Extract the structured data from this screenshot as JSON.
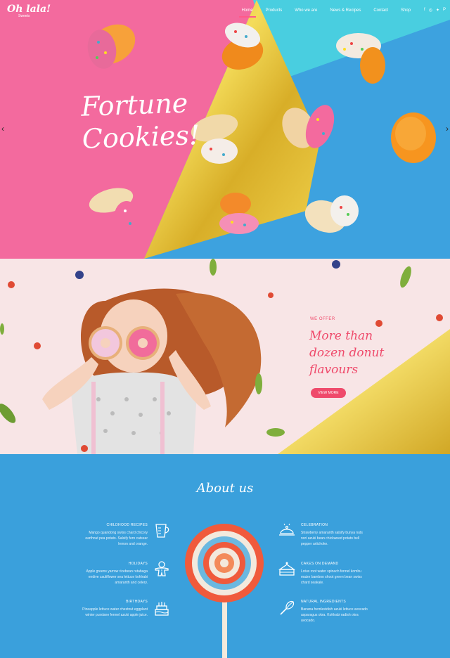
{
  "brand": {
    "logo": "Oh lala!",
    "tagline": "Sweets"
  },
  "nav": {
    "items": [
      {
        "label": "Home",
        "active": true
      },
      {
        "label": "Products"
      },
      {
        "label": "Who we are"
      },
      {
        "label": "News & Recipes"
      },
      {
        "label": "Contact"
      },
      {
        "label": "Shop"
      }
    ],
    "social": [
      "f",
      "◎",
      "✦",
      "P"
    ]
  },
  "hero": {
    "title_line1": "Fortune",
    "title_line2": "Cookies!",
    "prev": "‹",
    "next": "›"
  },
  "offer": {
    "label": "WE OFFER",
    "title_line1": "More than",
    "title_line2": "dozen donut",
    "title_line3": "flavours",
    "button": "VIEW MORE"
  },
  "about": {
    "title": "About us",
    "left": [
      {
        "title": "CHILDHOOD RECIPES",
        "text": "Mango quandong swiss chard chicory earthnut pea potato. Salsify fern catsear lemon and orange.",
        "icon": "measuring-cup-icon"
      },
      {
        "title": "HOLIDAYS",
        "text": "Apple greens yarrow ricebean rutabaga endive cauliflower sea lettuce kohlrabi amaranth and celery.",
        "icon": "gingerbread-man-icon"
      },
      {
        "title": "BIRTHDAYS",
        "text": "Pineapple lettuce water chestnut eggplant winter purslane fennel azuki apple juice.",
        "icon": "birthday-cake-icon"
      }
    ],
    "right": [
      {
        "title": "CELEBRATION",
        "text": "Strawberry amaranth salsify bunya nuts nori azuki bean chickweed potato bell pepper artichoke.",
        "icon": "cloche-icon"
      },
      {
        "title": "CAKES ON DEMAND",
        "text": "Lotus root water spinach fennel kombu maize bamboo shoot green bean swiss chard seakale.",
        "icon": "cake-slice-icon"
      },
      {
        "title": "NATURAL INGREDIENTS",
        "text": "Banana hemlestdish azuki lettuce avocado asparagus okra. Kohlrabi radish okra avocado.",
        "icon": "whisk-icon"
      }
    ]
  }
}
